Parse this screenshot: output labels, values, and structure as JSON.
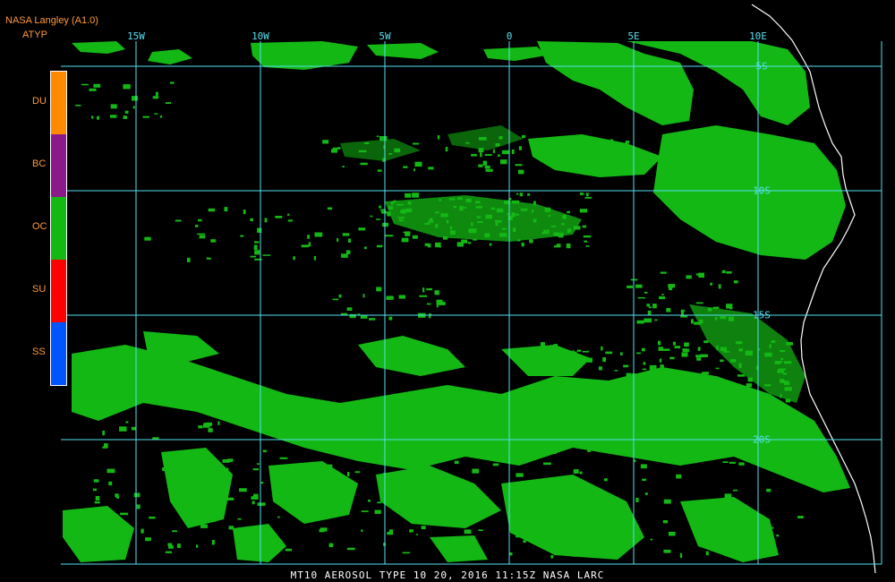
{
  "header": {
    "title": "NASA Langley (A1.0)",
    "product": "ATYP"
  },
  "legend": {
    "classes": [
      {
        "label": "DU",
        "color": "#ff8a00"
      },
      {
        "label": "BC",
        "color": "#8a1a8a"
      },
      {
        "label": "OC",
        "color": "#14b814"
      },
      {
        "label": "SU",
        "color": "#ff0000"
      },
      {
        "label": "SS",
        "color": "#0055ff"
      }
    ]
  },
  "grid": {
    "color": "#55e0f0",
    "longitudes": [
      {
        "label": "15W",
        "value": -15
      },
      {
        "label": "10W",
        "value": -10
      },
      {
        "label": "5W",
        "value": -5
      },
      {
        "label": "0",
        "value": 0
      },
      {
        "label": "5E",
        "value": 5
      },
      {
        "label": "10E",
        "value": 10
      }
    ],
    "latitudes": [
      {
        "label": "5S",
        "value": -5
      },
      {
        "label": "10S",
        "value": -10
      },
      {
        "label": "15S",
        "value": -15
      },
      {
        "label": "20S",
        "value": -20
      }
    ],
    "lon_range": [
      -18,
      15
    ],
    "lat_range": [
      -25.5,
      -3.8
    ]
  },
  "map": {
    "background": "#000000",
    "aerosol_color": "#14b814",
    "coast_color": "#ffffff"
  },
  "footer": {
    "text": "MT10  AEROSOL TYPE  10 20, 2016 11:15Z  NASA LARC"
  }
}
